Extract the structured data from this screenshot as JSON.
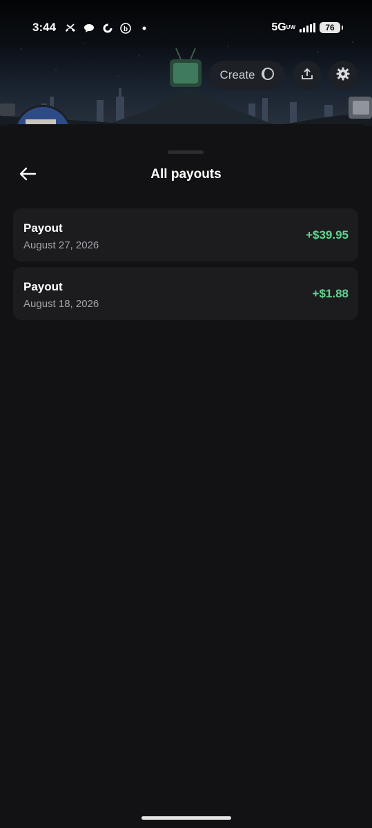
{
  "status_bar": {
    "time": "3:44",
    "network": "5G",
    "network_sub": "UW",
    "battery": "76"
  },
  "header": {
    "create_label": "Create",
    "icons": [
      "pencil-icon",
      "upload-icon",
      "gear-icon"
    ]
  },
  "page": {
    "title": "All payouts"
  },
  "payouts": [
    {
      "label": "Payout",
      "date": "August 27, 2026",
      "amount": "+$39.95"
    },
    {
      "label": "Payout",
      "date": "August 18, 2026",
      "amount": "+$1.88"
    }
  ],
  "colors": {
    "background": "#121214",
    "card": "#1c1c1f",
    "amount_positive": "#5fd68e",
    "secondary_text": "#a2a4a9"
  }
}
